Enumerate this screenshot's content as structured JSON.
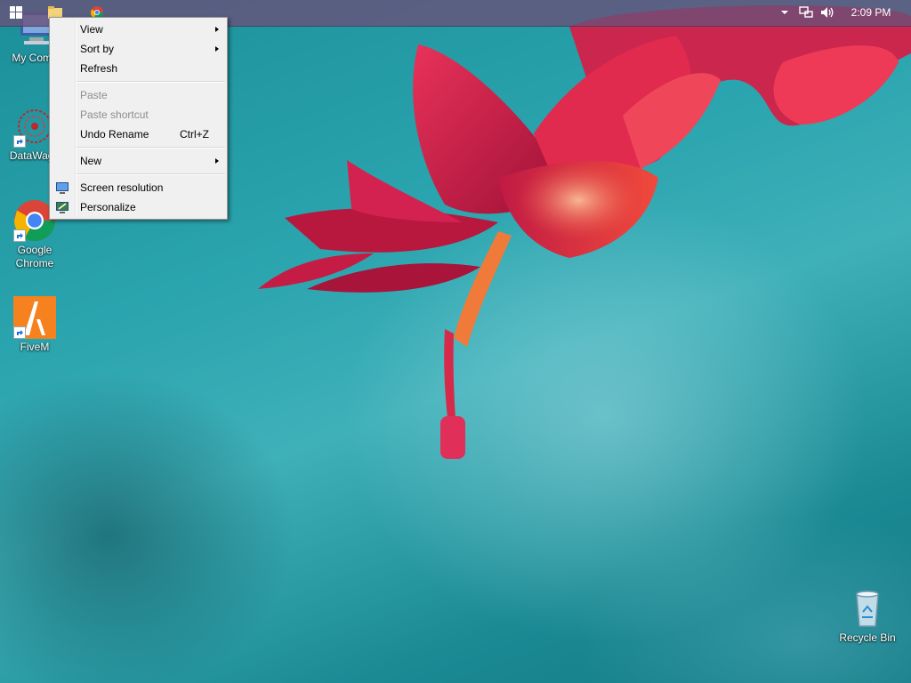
{
  "taskbar": {
    "start_icon": "windows-start-icon",
    "pinned": [
      {
        "icon": "file-explorer-icon"
      },
      {
        "icon": "chrome-icon"
      }
    ],
    "tray_icons": [
      "show-hidden-icons-chevron",
      "network-icon",
      "volume-icon"
    ],
    "clock": "2:09 PM"
  },
  "desktop_icons": [
    {
      "label": "My Comp",
      "icon": "computer-icon"
    },
    {
      "label": "DataWago",
      "icon": "datawago-icon"
    },
    {
      "label": "Google Chrome",
      "icon": "chrome-icon"
    },
    {
      "label": "FiveM",
      "icon": "fivem-icon"
    },
    {
      "label": "Recycle Bin",
      "icon": "recycle-bin-icon"
    }
  ],
  "context_menu": {
    "items": [
      {
        "label": "View",
        "submenu": true
      },
      {
        "label": "Sort by",
        "submenu": true
      },
      {
        "label": "Refresh"
      },
      {
        "label": "Paste",
        "disabled": true
      },
      {
        "label": "Paste shortcut",
        "disabled": true
      },
      {
        "label": "Undo Rename",
        "shortcut": "Ctrl+Z"
      },
      {
        "label": "New",
        "submenu": true
      },
      {
        "label": "Screen resolution",
        "icon": "screen-resolution-icon"
      },
      {
        "label": "Personalize",
        "icon": "personalize-icon"
      }
    ]
  },
  "colors": {
    "wallpaper_teal": "#2aa4ae",
    "flower_red": "#d8234f",
    "taskbar": "#695078",
    "menu_bg": "#f0f0f0"
  }
}
